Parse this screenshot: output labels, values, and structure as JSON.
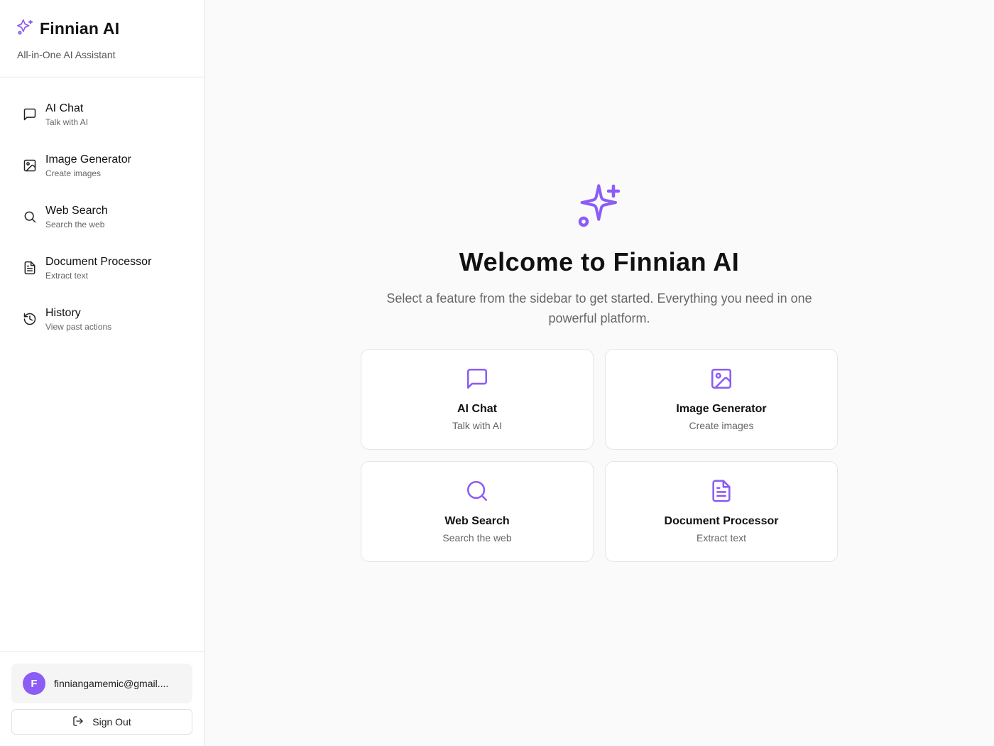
{
  "brand": {
    "title": "Finnian AI",
    "subtitle": "All-in-One AI Assistant",
    "icon": "sparkles-icon",
    "accent": "#8b5cf6"
  },
  "sidebar": {
    "items": [
      {
        "label": "AI Chat",
        "desc": "Talk with AI",
        "icon": "message-square-icon"
      },
      {
        "label": "Image Generator",
        "desc": "Create images",
        "icon": "image-icon"
      },
      {
        "label": "Web Search",
        "desc": "Search the web",
        "icon": "search-icon"
      },
      {
        "label": "Document Processor",
        "desc": "Extract text",
        "icon": "file-text-icon"
      },
      {
        "label": "History",
        "desc": "View past actions",
        "icon": "history-icon"
      }
    ]
  },
  "user": {
    "initial": "F",
    "email": "finniangamemic@gmail...."
  },
  "signout": {
    "label": "Sign Out",
    "icon": "log-out-icon"
  },
  "hero": {
    "title": "Welcome to Finnian AI",
    "subtitle": "Select a feature from the sidebar to get started. Everything you need in one powerful platform."
  },
  "cards": [
    {
      "title": "AI Chat",
      "desc": "Talk with AI",
      "icon": "message-square-icon"
    },
    {
      "title": "Image Generator",
      "desc": "Create images",
      "icon": "image-icon"
    },
    {
      "title": "Web Search",
      "desc": "Search the web",
      "icon": "search-icon"
    },
    {
      "title": "Document Processor",
      "desc": "Extract text",
      "icon": "file-text-icon"
    }
  ]
}
